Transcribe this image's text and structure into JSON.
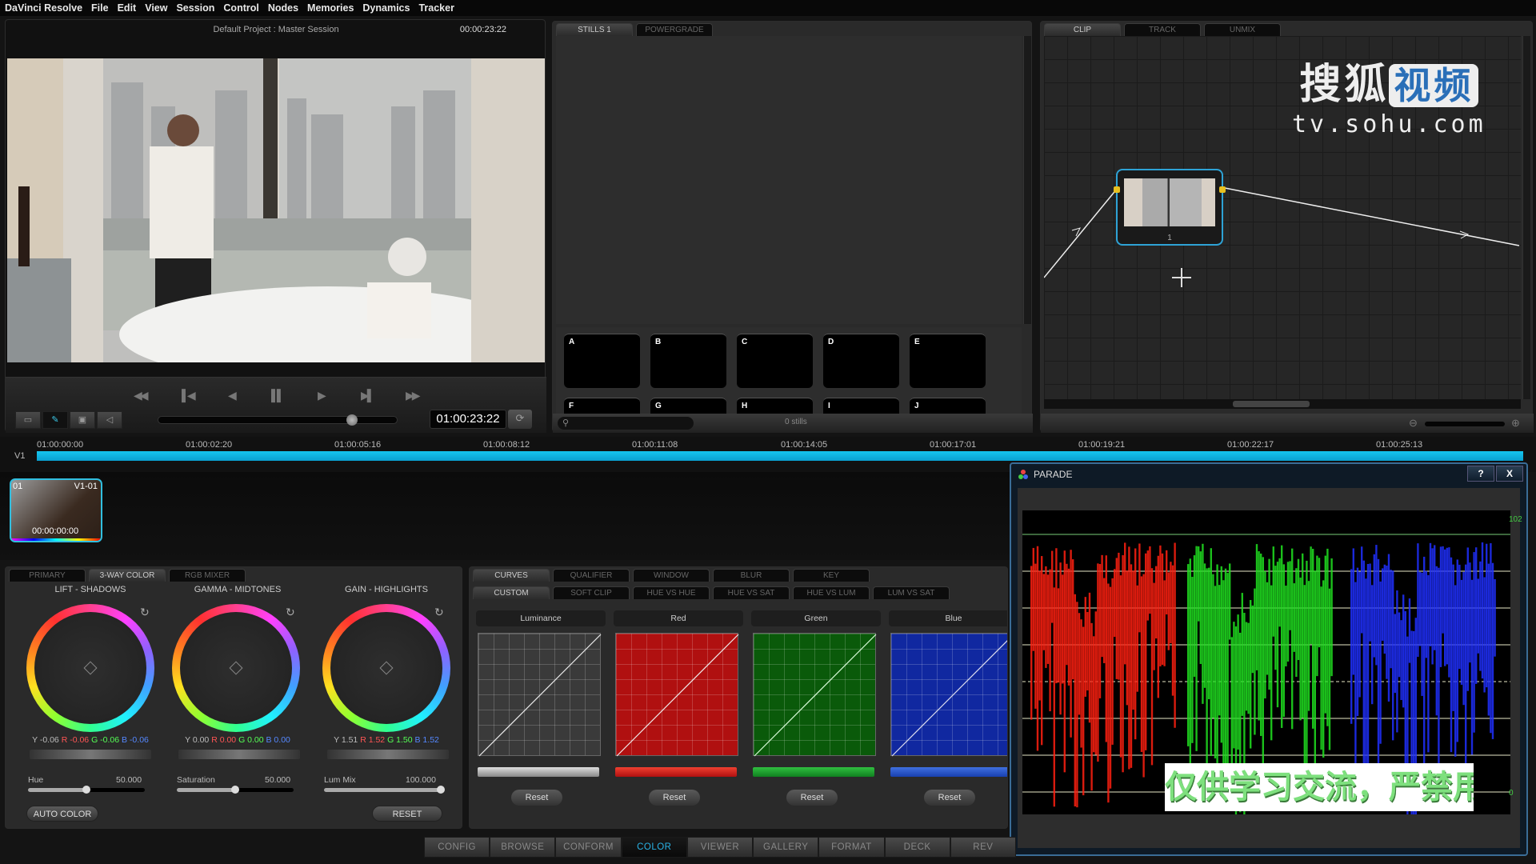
{
  "menu": [
    "DaVinci Resolve",
    "File",
    "Edit",
    "View",
    "Session",
    "Control",
    "Nodes",
    "Memories",
    "Dynamics",
    "Tracker"
  ],
  "viewer": {
    "title": "Default Project : Master Session",
    "timecode_top": "00:00:23:22",
    "timecode": "01:00:23:22",
    "scrub_position": 0.82,
    "transport": [
      "rewind-icon",
      "step-back-icon",
      "play-reverse-icon",
      "pause-icon",
      "play-icon",
      "step-forward-icon",
      "fast-forward-icon"
    ]
  },
  "stills": {
    "tabs": [
      "STILLS 1",
      "POWERGRADE"
    ],
    "memories": [
      "A",
      "B",
      "C",
      "D",
      "E",
      "F",
      "G",
      "H",
      "I",
      "J"
    ],
    "count": "0 stills",
    "search_placeholder": ""
  },
  "nodes": {
    "tabs": [
      "CLIP",
      "TRACK",
      "UNMIX"
    ],
    "node_label": "1",
    "watermark_cn": "搜狐",
    "watermark_badge": "视频",
    "watermark_url": "tv.sohu.com"
  },
  "timeline": {
    "track": "V1",
    "ticks": [
      "01:00:00:00",
      "01:00:02:20",
      "01:00:05:16",
      "01:00:08:12",
      "01:00:11:08",
      "01:00:14:05",
      "01:00:17:01",
      "01:00:19:21",
      "01:00:22:17",
      "01:00:25:13"
    ],
    "clip": {
      "num": "01",
      "track": "V1-01",
      "tc": "00:00:00:00"
    }
  },
  "primary": {
    "tabs": [
      "PRIMARY",
      "3-WAY COLOR",
      "RGB MIXER"
    ],
    "wheels": [
      {
        "title": "LIFT - SHADOWS",
        "y": "Y -0.06",
        "r": "R -0.06",
        "g": "G -0.06",
        "b": "B -0.06"
      },
      {
        "title": "GAMMA - MIDTONES",
        "y": "Y 0.00",
        "r": "R 0.00",
        "g": "G 0.00",
        "b": "B 0.00"
      },
      {
        "title": "GAIN - HIGHLIGHTS",
        "y": "Y 1.51",
        "r": "R 1.52",
        "g": "G 1.50",
        "b": "B 1.52"
      }
    ],
    "sliders": [
      {
        "label": "Hue",
        "value": "50.000",
        "fraction": 0.5
      },
      {
        "label": "Saturation",
        "value": "50.000",
        "fraction": 0.5
      },
      {
        "label": "Lum Mix",
        "value": "100.000",
        "fraction": 1.0
      }
    ],
    "auto_color": "AUTO COLOR",
    "reset": "RESET"
  },
  "curves": {
    "tabs_top": [
      "CURVES",
      "QUALIFIER",
      "WINDOW",
      "BLUR",
      "KEY"
    ],
    "tabs_sub": [
      "CUSTOM",
      "SOFT CLIP",
      "HUE VS HUE",
      "HUE VS SAT",
      "HUE VS LUM",
      "LUM VS SAT"
    ],
    "channels": [
      {
        "label": "Luminance",
        "reset": "Reset",
        "color": "#555555"
      },
      {
        "label": "Red",
        "reset": "Reset",
        "color": "#c01010"
      },
      {
        "label": "Green",
        "reset": "Reset",
        "color": "#0a6a0a"
      },
      {
        "label": "Blue",
        "reset": "Reset",
        "color": "#1030b0"
      }
    ]
  },
  "parade": {
    "title": "PARADE",
    "help": "?",
    "close": "X",
    "max_label": "102",
    "min_label": "0",
    "overlay_text": "仅供学习交流，严禁用于商业"
  },
  "pages": [
    "CONFIG",
    "BROWSE",
    "CONFORM",
    "COLOR",
    "VIEWER",
    "GALLERY",
    "FORMAT",
    "DECK",
    "REV"
  ],
  "active_page": "COLOR",
  "colors": {
    "accent": "#2ab3e6",
    "timeline": "#15c6f0",
    "node_border": "#2ea3d6"
  }
}
